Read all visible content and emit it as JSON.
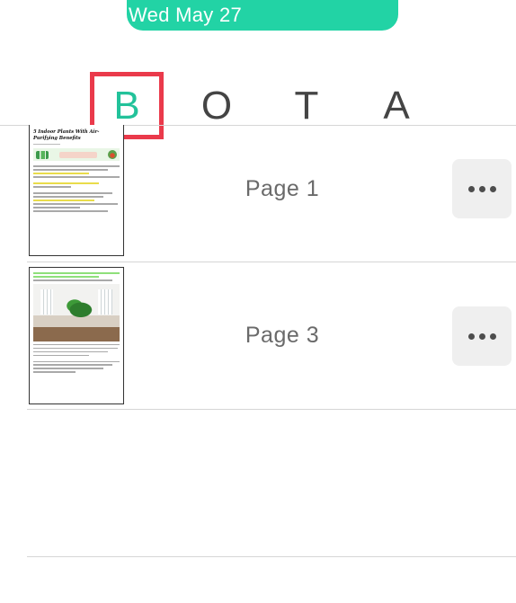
{
  "status": {
    "date": "Wed May 27"
  },
  "tabs": [
    {
      "label": "B",
      "active": true
    },
    {
      "label": "O",
      "active": false
    },
    {
      "label": "T",
      "active": false
    },
    {
      "label": "A",
      "active": false
    }
  ],
  "colors": {
    "accent": "#22d3a5",
    "active_tab": "#22c29a",
    "highlight_box": "#ea3a4b"
  },
  "pages": [
    {
      "label": "Page 1",
      "thumbnail_title": "5 Indoor Plants With Air-Purifying Benefits",
      "more_icon": "more-horizontal-icon"
    },
    {
      "label": "Page 3",
      "more_icon": "more-horizontal-icon"
    }
  ]
}
